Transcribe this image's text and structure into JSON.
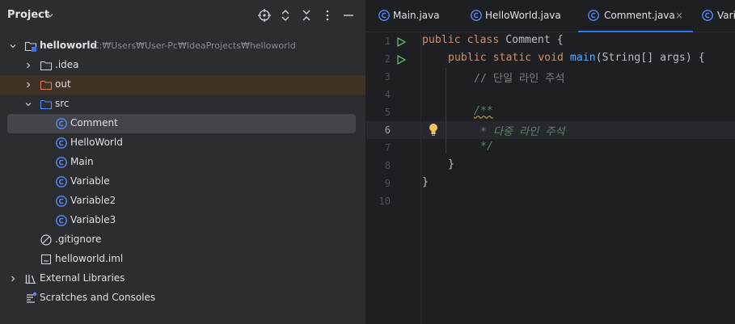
{
  "project_panel": {
    "title": "Project",
    "tools": [
      "crosshair-icon",
      "expand-all-icon",
      "collapse-all-icon",
      "more-icon",
      "minimize-icon"
    ],
    "tree": [
      {
        "label": "helloworld",
        "path": "C:₩Users₩User-Pc₩IdeaProjects₩helloworld",
        "icon": "module-folder-icon",
        "expanded": true
      },
      {
        "label": ".idea",
        "icon": "folder-icon",
        "expanded": false
      },
      {
        "label": "out",
        "icon": "excluded-folder-icon",
        "expanded": false
      },
      {
        "label": "src",
        "icon": "source-folder-icon",
        "expanded": true
      },
      {
        "label": "Comment",
        "icon": "java-class-icon",
        "selected": true
      },
      {
        "label": "HelloWorld",
        "icon": "java-class-icon"
      },
      {
        "label": "Main",
        "icon": "java-class-icon"
      },
      {
        "label": "Variable",
        "icon": "java-class-icon"
      },
      {
        "label": "Variable2",
        "icon": "java-class-icon"
      },
      {
        "label": "Variable3",
        "icon": "java-class-icon"
      },
      {
        "label": ".gitignore",
        "icon": "ignored-file-icon"
      },
      {
        "label": "helloworld.iml",
        "icon": "module-file-icon"
      },
      {
        "label": "External Libraries",
        "icon": "library-icon",
        "expanded": false
      },
      {
        "label": "Scratches and Consoles",
        "icon": "scratches-icon"
      }
    ]
  },
  "editor": {
    "tabs": [
      {
        "label": "Main.java",
        "active": false
      },
      {
        "label": "HelloWorld.java",
        "active": false
      },
      {
        "label": "Comment.java",
        "active": true,
        "close": "×"
      },
      {
        "label": "Vari",
        "active": false
      }
    ],
    "line_numbers": [
      "1",
      "2",
      "3",
      "4",
      "5",
      "6",
      "7",
      "8",
      "9",
      "10"
    ],
    "current_line": "6",
    "lines": [
      {
        "kw1": "public",
        "kw2": "class",
        "rest": " Comment {"
      },
      {
        "kw1": "public",
        "kw2": "static",
        "kw3": "void",
        "fn": "main",
        "rest": "(String[] args) {"
      },
      {
        "comment": "// 단일 라인 주석"
      },
      {},
      {
        "doc": "/**"
      },
      {
        "doc": "* 다중 라인 주석"
      },
      {
        "doc": "*/"
      },
      {
        "rest": "}"
      },
      {
        "rest": "}"
      },
      {}
    ]
  },
  "colors": {
    "accent": "#3574f0",
    "run": "#5fb865",
    "bulb": "#f2c55c",
    "class_icon": "#548af7"
  }
}
